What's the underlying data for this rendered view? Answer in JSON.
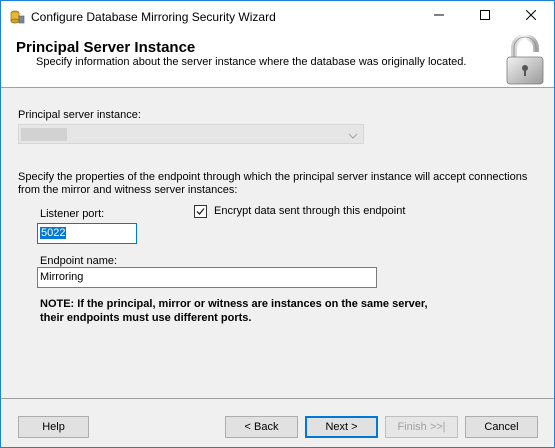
{
  "window": {
    "title": "Configure Database Mirroring Security Wizard"
  },
  "header": {
    "title": "Principal Server Instance",
    "subtitle": "Specify information about the server instance where the database was originally located."
  },
  "form": {
    "principal_label": "Principal server instance:",
    "principal_value": "",
    "endpoint_description_line1": "Specify the properties of the endpoint through which the principal server instance will accept connections",
    "endpoint_description_line2": "from the mirror and witness server instances:",
    "listener_port_label": "Listener port:",
    "listener_port_value": "5022",
    "encrypt_label": "Encrypt data sent through this endpoint",
    "encrypt_checked": true,
    "endpoint_name_label": "Endpoint name:",
    "endpoint_name_value": "Mirroring",
    "note_line1": "NOTE: If the principal, mirror or witness are instances on the same server,",
    "note_line2": "their endpoints must use different ports."
  },
  "buttons": {
    "help": "Help",
    "back": "< Back",
    "next": "Next >",
    "finish": "Finish >>|",
    "cancel": "Cancel"
  },
  "icons": {
    "app": "database-wizard-icon",
    "header": "lock-icon",
    "minimize": "minimize-icon",
    "maximize": "maximize-icon",
    "close": "close-icon",
    "dropdown": "chevron-down-icon",
    "checkbox": "checkmark-icon"
  }
}
